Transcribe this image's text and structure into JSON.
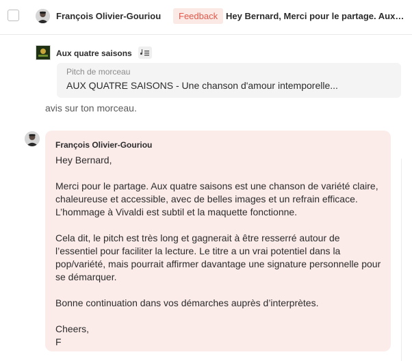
{
  "row": {
    "sender": "François Olivier-Gouriou",
    "badge": "Feedback",
    "preview": "Hey Bernard, Merci pour le partage. Aux quatre saisons est une chanson de variété"
  },
  "song": {
    "title": "Aux quatre saisons",
    "pitch_label": "Pitch de morceau",
    "pitch_text": "AUX QUATRE SAISONS - Une chanson d'amour intemporelle..."
  },
  "previous_message_tail": "avis sur ton morceau.",
  "message": {
    "author": "François Olivier-Gouriou",
    "greeting": "Hey Bernard,",
    "p1": "Merci pour le partage. Aux quatre saisons est une chanson de variété claire, chaleureuse et accessible, avec de belles images et un refrain efficace. L’hommage à Vivaldi est subtil et la maquette fonctionne.",
    "p2": "Cela dit, le pitch est très long et gagnerait à être resserré autour de l’essentiel pour faciliter la lecture. Le titre a un vrai potentiel dans la pop/variété, mais pourrait affirmer davantage une signature personnelle pour se démarquer.",
    "p3": "Bonne continuation dans vos démarches auprès d’interprètes.",
    "signoff": "Cheers,",
    "initial": "F"
  },
  "colors": {
    "badge_bg": "#fbe9e6",
    "badge_text": "#e0584a",
    "message_bg": "#fbecea",
    "pitch_bg": "#f4f4f4"
  }
}
